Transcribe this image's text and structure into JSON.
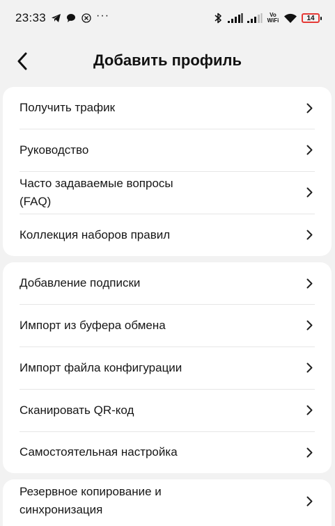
{
  "status_bar": {
    "time": "23:33",
    "dots": "···",
    "vowifi_top": "Vo",
    "vowifi_bottom": "WiFi",
    "battery": "14"
  },
  "header": {
    "title": "Добавить профиль"
  },
  "groups": [
    {
      "items": [
        {
          "label": "Получить трафик"
        },
        {
          "label": "Руководство"
        },
        {
          "label": "Часто задаваемые вопросы (FAQ)"
        },
        {
          "label": "Коллекция наборов правил"
        }
      ]
    },
    {
      "items": [
        {
          "label": "Добавление подписки"
        },
        {
          "label": "Импорт из буфера обмена"
        },
        {
          "label": "Импорт файла конфигурации"
        },
        {
          "label": "Сканировать QR-код"
        },
        {
          "label": "Самостоятельная настройка"
        }
      ]
    },
    {
      "items": [
        {
          "label": "Резервное копирование и синхронизация"
        }
      ]
    }
  ]
}
